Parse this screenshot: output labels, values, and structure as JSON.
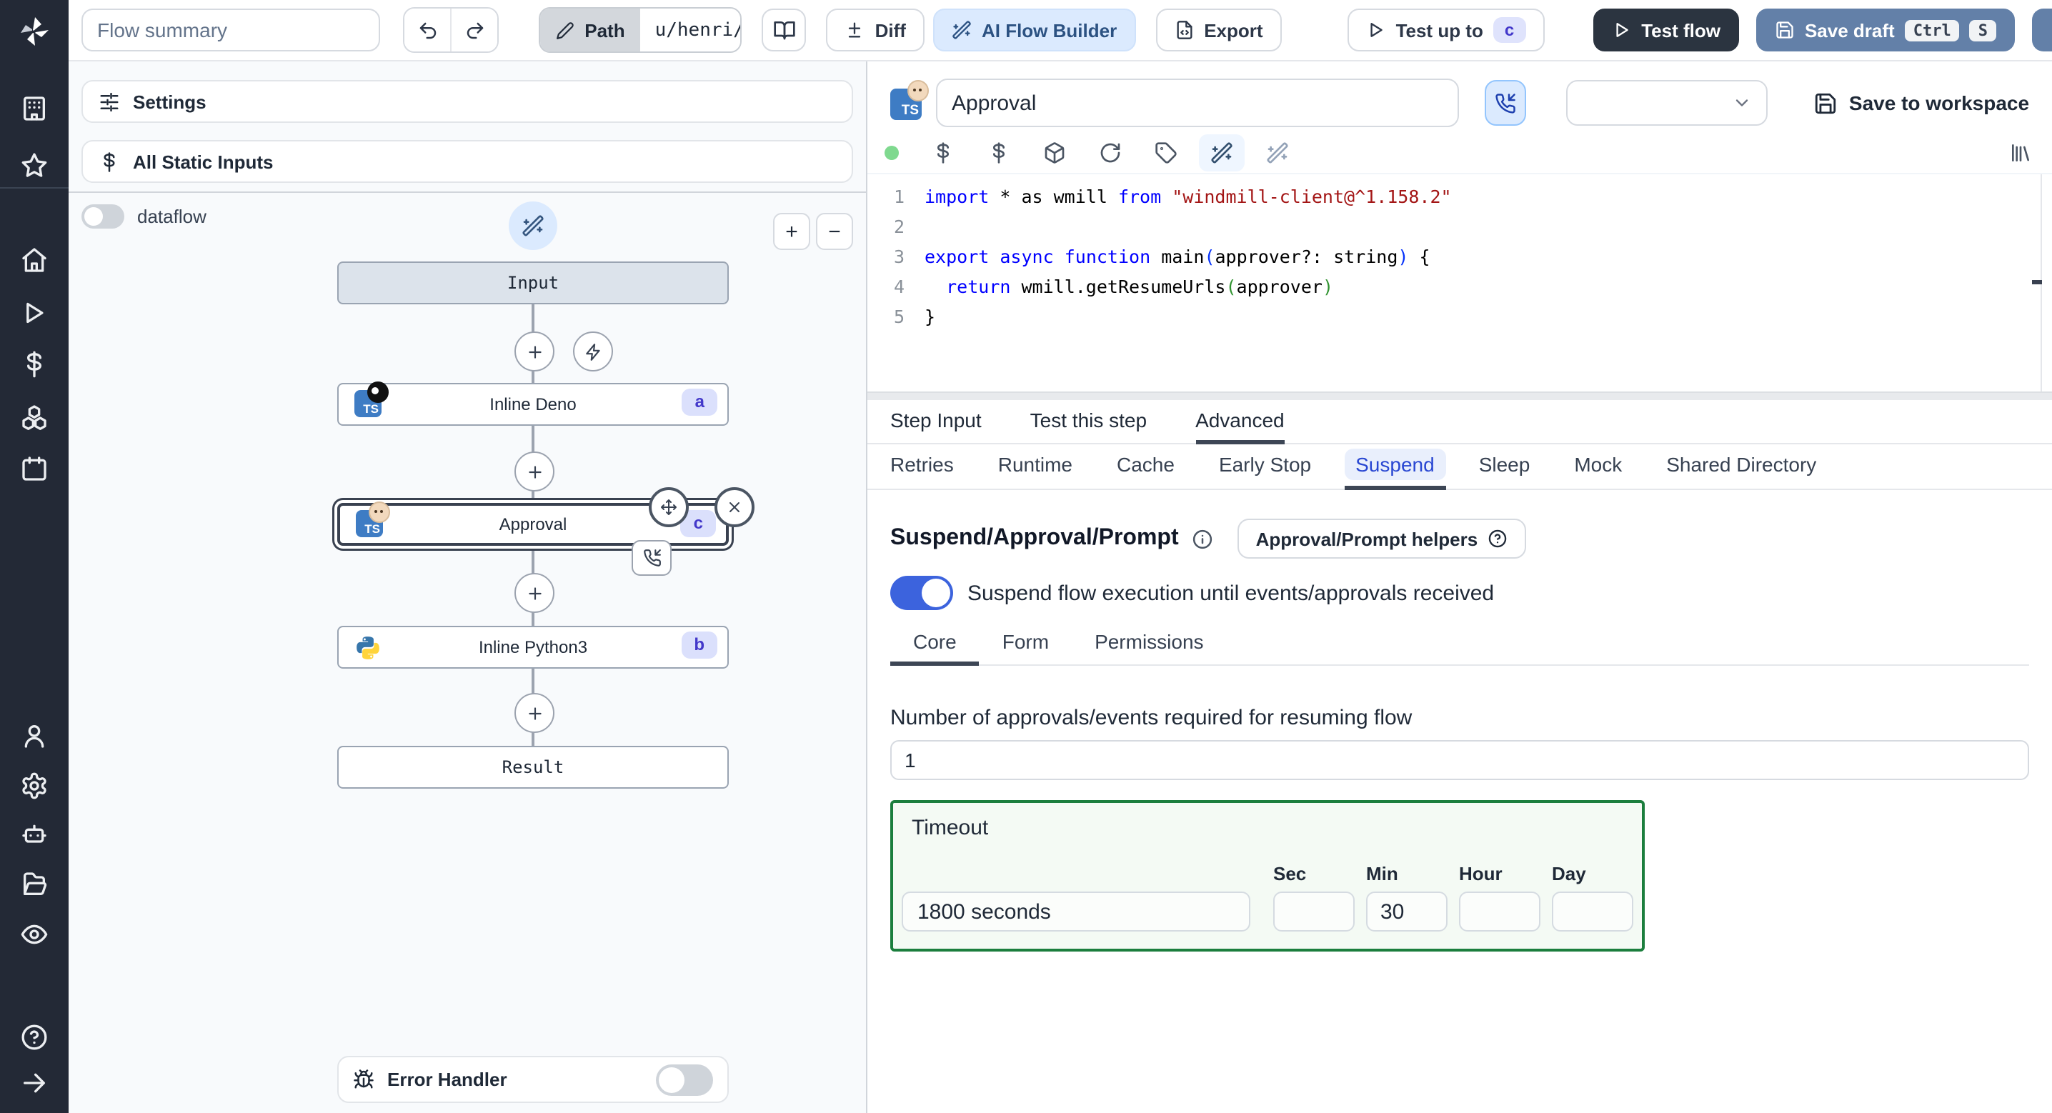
{
  "topbar": {
    "flow_summary_placeholder": "Flow summary",
    "path_label": "Path",
    "path_value": "u/henri/bes",
    "diff_label": "Diff",
    "ai_flow_builder_label": "AI Flow Builder",
    "export_label": "Export",
    "test_up_to_label": "Test up to",
    "test_up_to_badge": "c",
    "test_flow_label": "Test flow",
    "save_draft_label": "Save draft",
    "shortcut_mod": "Ctrl",
    "shortcut_key": "S"
  },
  "sidebar": {
    "icons": [
      "windmill-logo",
      "building-icon",
      "star-icon",
      "home-icon",
      "play-icon",
      "dollar-icon",
      "boxes-icon",
      "calendar-icon",
      "user-icon",
      "settings-gear-icon",
      "bot-icon",
      "folder-open-icon",
      "eye-icon",
      "help-circle-icon",
      "arrow-right-icon"
    ]
  },
  "flow_panel": {
    "settings_label": "Settings",
    "static_inputs_label": "All Static Inputs",
    "dataflow_label": "dataflow",
    "zoom_in_label": "+",
    "zoom_out_label": "−",
    "nodes": {
      "input": {
        "label": "Input"
      },
      "deno": {
        "label": "Inline Deno",
        "badge": "a"
      },
      "approval": {
        "label": "Approval",
        "badge": "c"
      },
      "python": {
        "label": "Inline Python3",
        "badge": "b"
      },
      "result": {
        "label": "Result"
      }
    },
    "error_handler_label": "Error Handler"
  },
  "step_panel": {
    "name_value": "Approval",
    "save_to_workspace_label": "Save to workspace",
    "tabs": [
      "Step Input",
      "Test this step",
      "Advanced"
    ],
    "active_tab": "Advanced",
    "advanced_tabs": [
      "Retries",
      "Runtime",
      "Cache",
      "Early Stop",
      "Suspend",
      "Sleep",
      "Mock",
      "Shared Directory"
    ],
    "active_advanced_tab": "Suspend",
    "suspend": {
      "heading": "Suspend/Approval/Prompt",
      "helpers_button_label": "Approval/Prompt helpers",
      "toggle_label": "Suspend flow execution until events/approvals received",
      "toggle_on": true,
      "tabs": [
        "Core",
        "Form",
        "Permissions"
      ],
      "active_tab": "Core",
      "approvals_label": "Number of approvals/events required for resuming flow",
      "approvals_value": "1",
      "timeout": {
        "legend": "Timeout",
        "seconds_value": "1800 seconds",
        "units": [
          "Sec",
          "Min",
          "Hour",
          "Day"
        ],
        "sec_value": "",
        "min_value": "30",
        "hour_value": "",
        "day_value": ""
      }
    }
  },
  "editor": {
    "language_icon": "typescript",
    "status_dot_color": "#7fd98f",
    "lines": [
      [
        [
          "kw",
          "import"
        ],
        [
          "pl",
          " * as wmill "
        ],
        [
          "kw",
          "from"
        ],
        [
          "pl",
          " "
        ],
        [
          "str",
          "\"windmill-client@^1.158.2\""
        ]
      ],
      [],
      [
        [
          "kw",
          "export"
        ],
        [
          "pl",
          " "
        ],
        [
          "kw",
          "async"
        ],
        [
          "pl",
          " "
        ],
        [
          "kw",
          "function"
        ],
        [
          "pl",
          " main"
        ],
        [
          "p1",
          "("
        ],
        [
          "pl",
          "approver?: string"
        ],
        [
          "p1",
          ")"
        ],
        [
          "pl",
          " {"
        ]
      ],
      [
        [
          "pl",
          "  "
        ],
        [
          "kw",
          "return"
        ],
        [
          "pl",
          " wmill.getResumeUrls"
        ],
        [
          "p2",
          "("
        ],
        [
          "pl",
          "approver"
        ],
        [
          "p2",
          ")"
        ]
      ],
      [
        [
          "pl",
          "}"
        ]
      ]
    ]
  },
  "colors": {
    "accent_blue": "#2947d2",
    "toggle_on_blue": "#3c63dd",
    "timeout_green": "#1b7e3d",
    "save_draft_blue": "#6380a8",
    "dark_button": "#2b3440",
    "badge_bg": "#dbe0fc",
    "badge_text": "#4338ca",
    "ai_button_bg": "#dbeafe",
    "rail_bg": "#232936",
    "keyword_blue": "#0000ff",
    "string_red": "#a31515"
  }
}
